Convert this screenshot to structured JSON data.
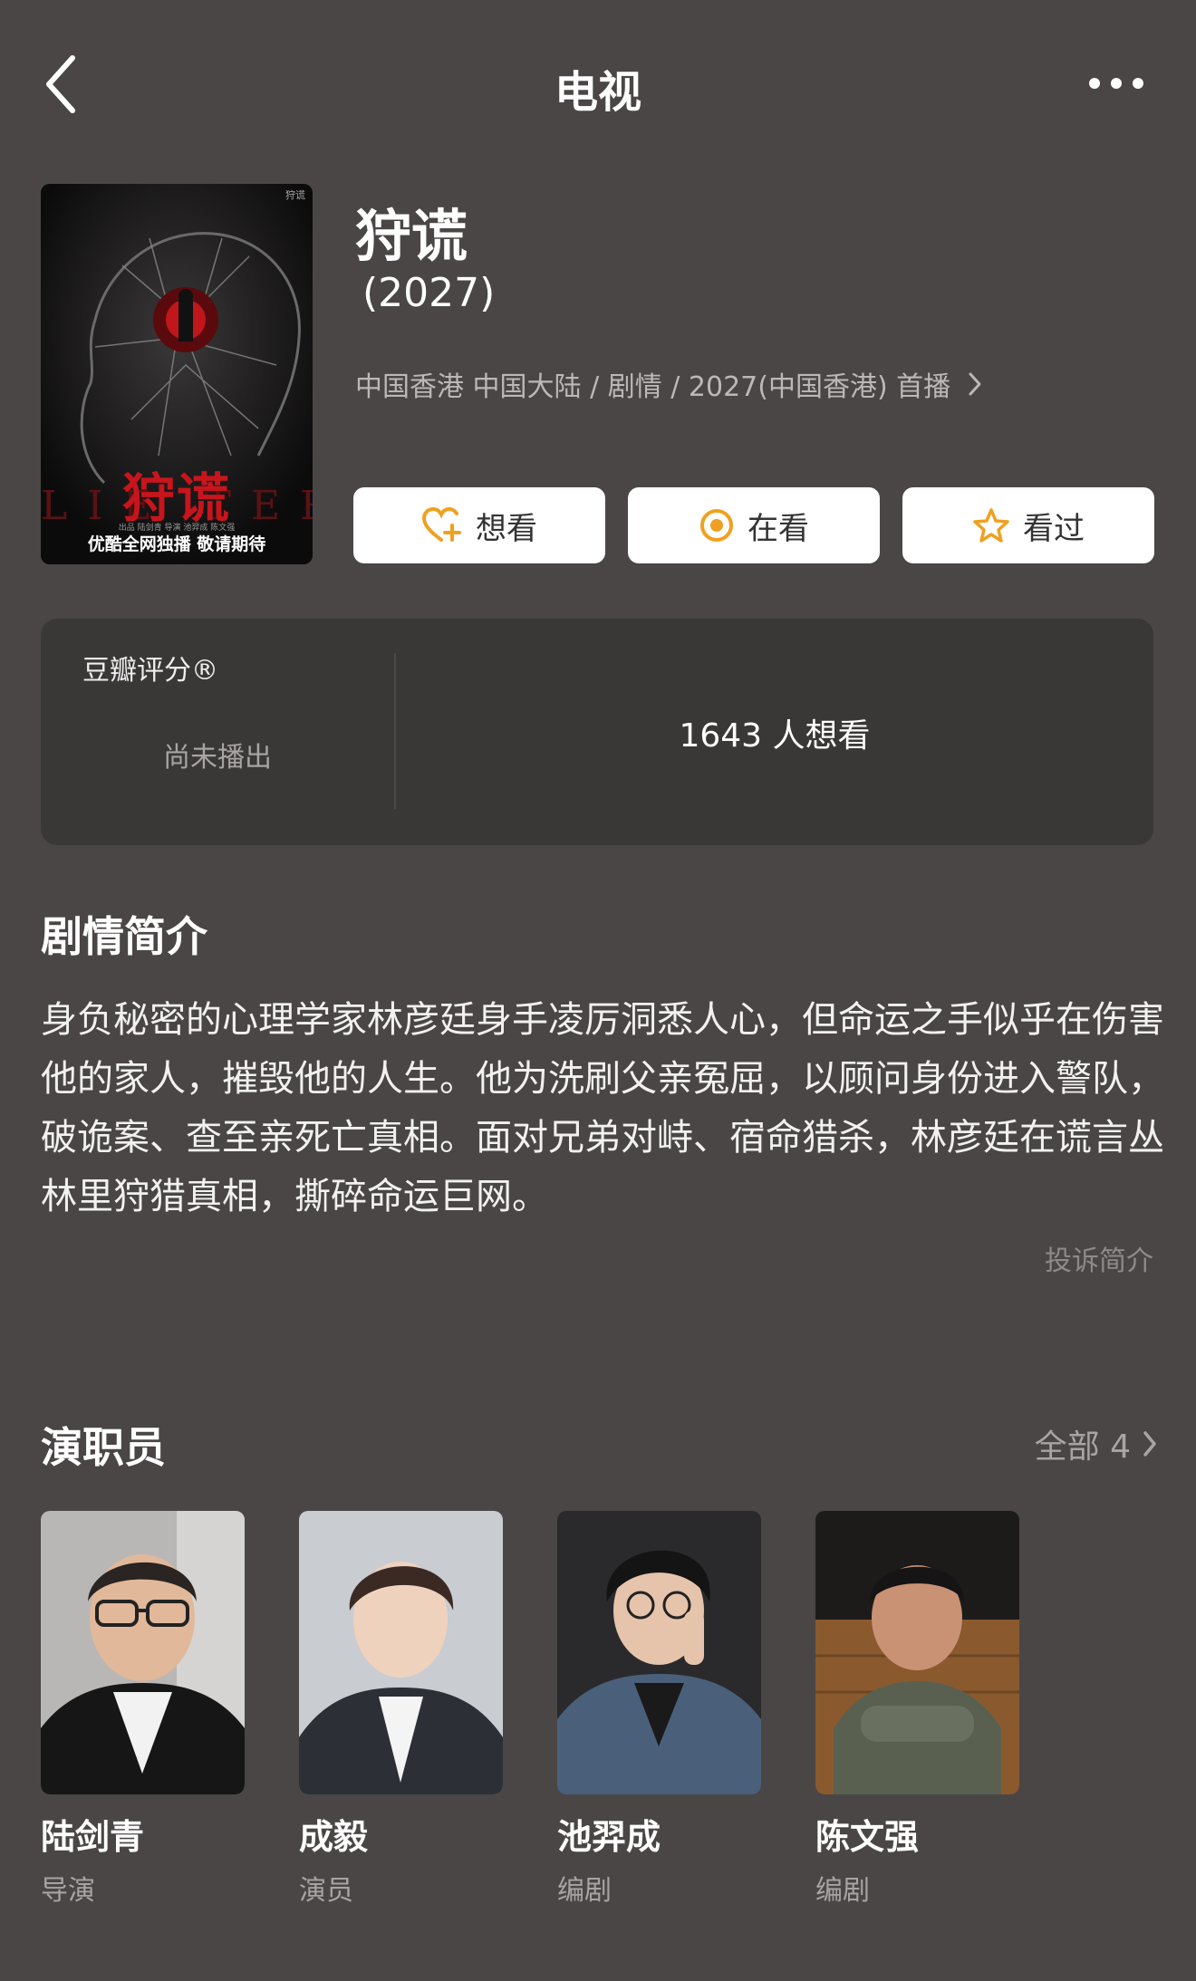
{
  "header": {
    "title": "电视"
  },
  "poster": {
    "title": "狩谎",
    "caption": "优酷全网独播 敬请期待",
    "corner_text": "狩谎",
    "credits": "出品 陆剑青 导演 池羿成 陈文强"
  },
  "show": {
    "title": "狩谎",
    "year": "(2027)",
    "meta": "中国香港 中国大陆 / 剧情 / 2027(中国香港) 首播"
  },
  "actions": [
    {
      "label": "想看",
      "icon": "heart-plus-icon"
    },
    {
      "label": "在看",
      "icon": "target-icon"
    },
    {
      "label": "看过",
      "icon": "star-icon"
    }
  ],
  "rating": {
    "label": "豆瓣评分®",
    "status": "尚未播出",
    "want_count": "1643 人想看"
  },
  "synopsis": {
    "title": "剧情简介",
    "text": "身负秘密的心理学家林彦廷身手凌厉洞悉人心，但命运之手似乎在伤害他的家人，摧毁他的人生。他为洗刷父亲冤屈，以顾问身份进入警队，破诡案、查至亲死亡真相。面对兄弟对峙、宿命猎杀，林彦廷在谎言丛林里狩猎真相，撕碎命运巨网。",
    "report": "投诉简介"
  },
  "cast": {
    "title": "演职员",
    "all_label": "全部 4",
    "members": [
      {
        "name": "陆剑青",
        "role": "导演"
      },
      {
        "name": "成毅",
        "role": "演员"
      },
      {
        "name": "池羿成",
        "role": "编剧"
      },
      {
        "name": "陈文强",
        "role": "编剧"
      }
    ]
  },
  "colors": {
    "background": "#4a4646",
    "card": "#3a3737",
    "accent": "#f0a020",
    "muted_text": "#a9a4a4"
  }
}
